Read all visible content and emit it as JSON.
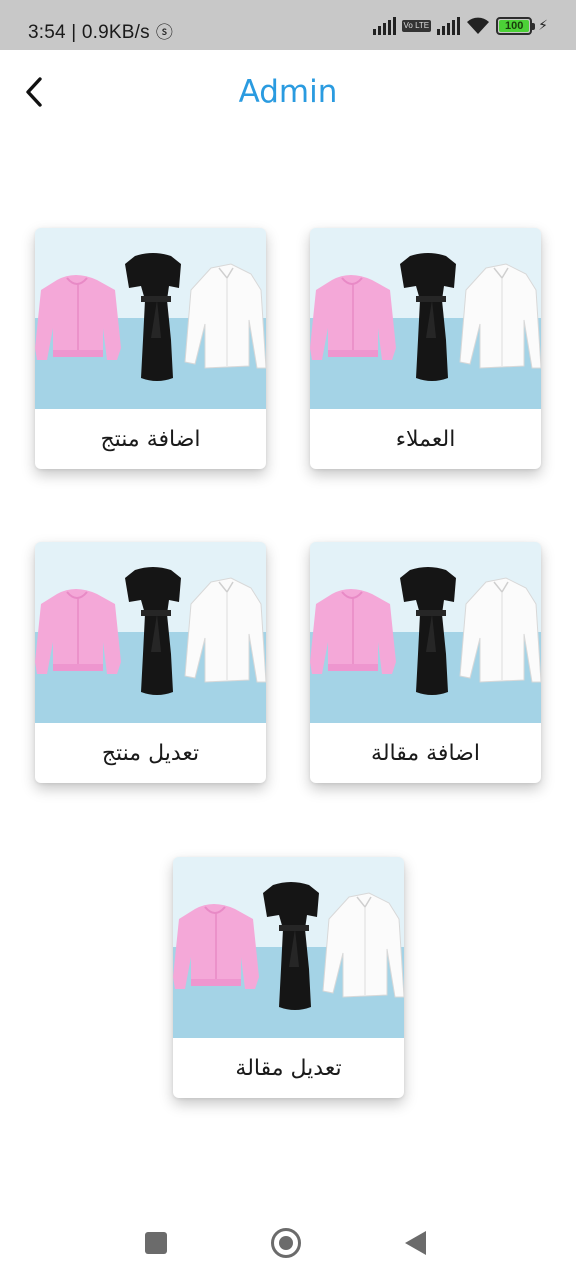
{
  "status_bar": {
    "time_speed": "3:54 | 0.9KB/s",
    "volte": "Vo LTE",
    "battery_level": "100"
  },
  "app_bar": {
    "title": "Admin"
  },
  "cards": [
    {
      "label": "العملاء"
    },
    {
      "label": "اضافة منتج"
    },
    {
      "label": "اضافة مقالة"
    },
    {
      "label": "تعديل منتج"
    },
    {
      "label": "تعديل مقالة"
    }
  ],
  "colors": {
    "title": "#2a9be0",
    "status_bar_bg": "#c8c8c8",
    "card_image_sky": "#e3f2f8",
    "card_image_ground": "#a4d3e6"
  }
}
